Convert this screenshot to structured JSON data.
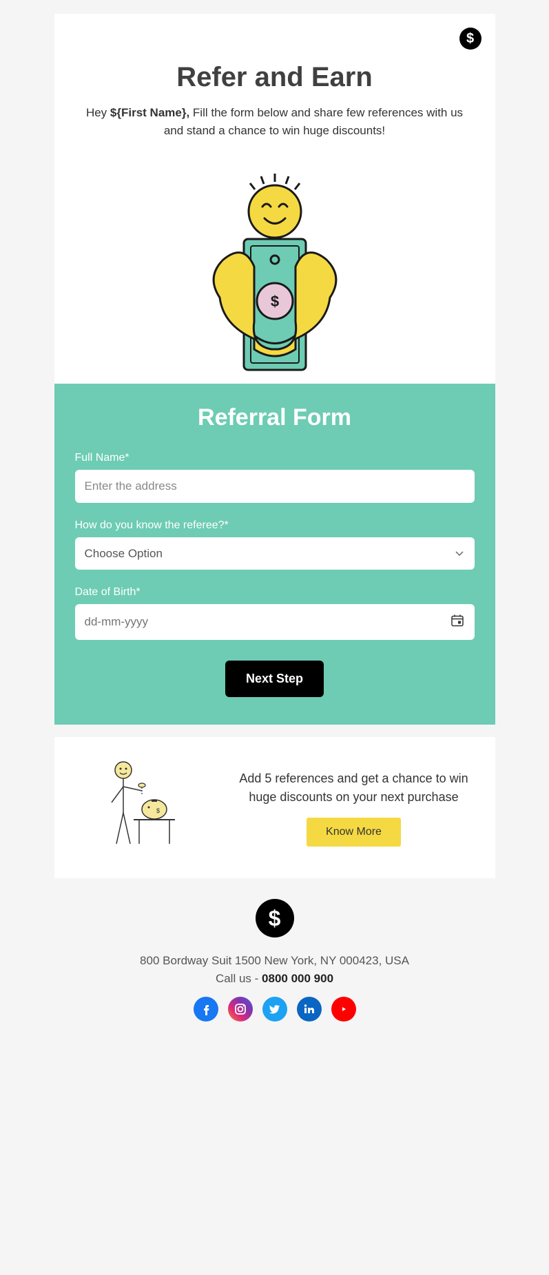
{
  "header": {
    "title": "Refer and Earn",
    "greeting_prefix": "Hey ",
    "greeting_var": "${First Name},",
    "greeting_rest": " Fill the form below and share few references with us and stand a chance to win huge discounts!"
  },
  "form": {
    "title": "Referral Form",
    "fullname_label": "Full Name*",
    "fullname_placeholder": "Enter the address",
    "relation_label": "How do you know the referee?*",
    "relation_placeholder": "Choose Option",
    "dob_label": "Date of Birth*",
    "dob_placeholder": "dd-mm-yyyy",
    "next_label": "Next Step"
  },
  "info": {
    "text": "Add 5 references and get a chance to win huge discounts on your next purchase",
    "cta": "Know More"
  },
  "footer": {
    "address": "800 Bordway Suit 1500 New York, NY 000423, USA",
    "call_prefix": "Call us - ",
    "phone": "0800 000 900"
  }
}
